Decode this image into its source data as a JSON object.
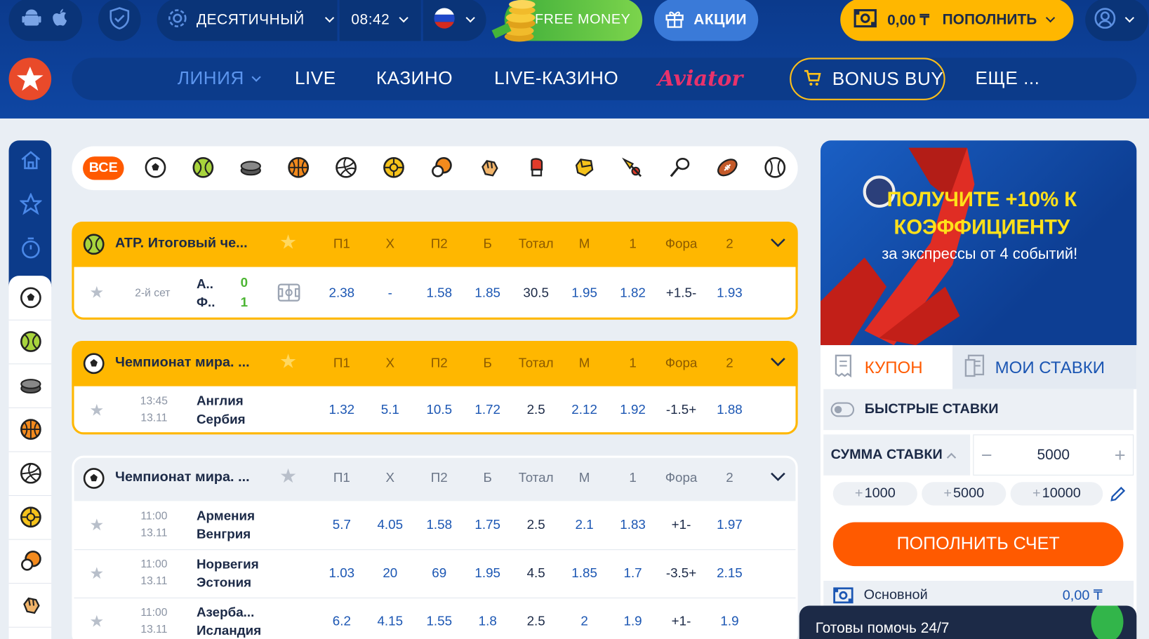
{
  "header": {
    "odds_format": "ДЕСЯТИЧНЫЙ",
    "time": "08:42",
    "free_money": "FREE MONEY",
    "promos": "АКЦИИ",
    "balance": "0,00 ₸",
    "deposit": "ПОПОЛНИТЬ",
    "nav": [
      "ЛИНИЯ",
      "LIVE",
      "КАЗИНО",
      "LIVE-КАЗИНО",
      "Aviator",
      "BONUS BUY",
      "ЕЩЕ ..."
    ]
  },
  "sports_filter": {
    "all": "ВСЕ",
    "icons": [
      "football-icon",
      "tennis-icon",
      "hockey-icon",
      "basketball-icon",
      "volleyball-icon",
      "handball-icon",
      "table-tennis-icon",
      "mma-icon",
      "boxing-icon",
      "martial-arts-icon",
      "badminton-icon",
      "squash-icon",
      "american-football-icon",
      "baseball-icon"
    ]
  },
  "columns": [
    "П1",
    "Х",
    "П2",
    "Б",
    "Тотал",
    "М",
    "1",
    "Фора",
    "2"
  ],
  "leagues": [
    {
      "name": "ATP. Итоговый че...",
      "icon": "tennis-icon",
      "matches": [
        {
          "time": "2-й сет",
          "date": "",
          "team1": "А..",
          "team2": "Ф..",
          "score1": "0",
          "score2": "1",
          "odds": [
            "2.38",
            "-",
            "1.58",
            "1.85",
            "30.5",
            "1.95",
            "1.82",
            "+1.5-",
            "1.93"
          ]
        }
      ]
    },
    {
      "name": "Чемпионат мира. ...",
      "icon": "football-icon",
      "matches": [
        {
          "time": "13:45",
          "date": "13.11",
          "team1": "Англия",
          "team2": "Сербия",
          "odds": [
            "1.32",
            "5.1",
            "10.5",
            "1.72",
            "2.5",
            "2.12",
            "1.92",
            "-1.5+",
            "1.88"
          ]
        }
      ]
    },
    {
      "name": "Чемпионат мира. ...",
      "icon": "football-icon",
      "matches": [
        {
          "time": "11:00",
          "date": "13.11",
          "team1": "Армения",
          "team2": "Венгрия",
          "odds": [
            "5.7",
            "4.05",
            "1.58",
            "1.75",
            "2.5",
            "2.1",
            "1.83",
            "+1-",
            "1.97"
          ]
        },
        {
          "time": "11:00",
          "date": "13.11",
          "team1": "Норвегия",
          "team2": "Эстония",
          "odds": [
            "1.03",
            "20",
            "69",
            "1.95",
            "4.5",
            "1.85",
            "1.7",
            "-3.5+",
            "2.15"
          ]
        },
        {
          "time": "11:00",
          "date": "13.11",
          "team1": "Азерба...",
          "team2": "Исландия",
          "odds": [
            "6.2",
            "4.15",
            "1.55",
            "1.8",
            "2.5",
            "2",
            "1.9",
            "+1-",
            "1.9"
          ]
        }
      ]
    }
  ],
  "banner": {
    "title": "ПОЛУЧИТЕ +10% К КОЭФФИЦИЕНТУ",
    "subtitle": "за экспрессы от 4 событий!"
  },
  "coupon": {
    "tab_coupon": "КУПОН",
    "tab_my_bets": "МОИ СТАВКИ",
    "quick_bets": "БЫСТРЫЕ СТАВКИ",
    "stake_label": "СУММА СТАВКИ",
    "stake_value": "5000",
    "chips": [
      "1000",
      "5000",
      "10000"
    ],
    "deposit_button": "ПОПОЛНИТЬ СЧЕТ",
    "account_label": "Основной",
    "account_value": "0,00 ₸"
  },
  "chat": {
    "text": "Готовы помочь 24/7"
  },
  "colors": {
    "brand_blue": "#0d3e93",
    "accent_orange": "#ff5a00",
    "league_yellow": "#ffb700",
    "odds_blue": "#1b56b3"
  }
}
